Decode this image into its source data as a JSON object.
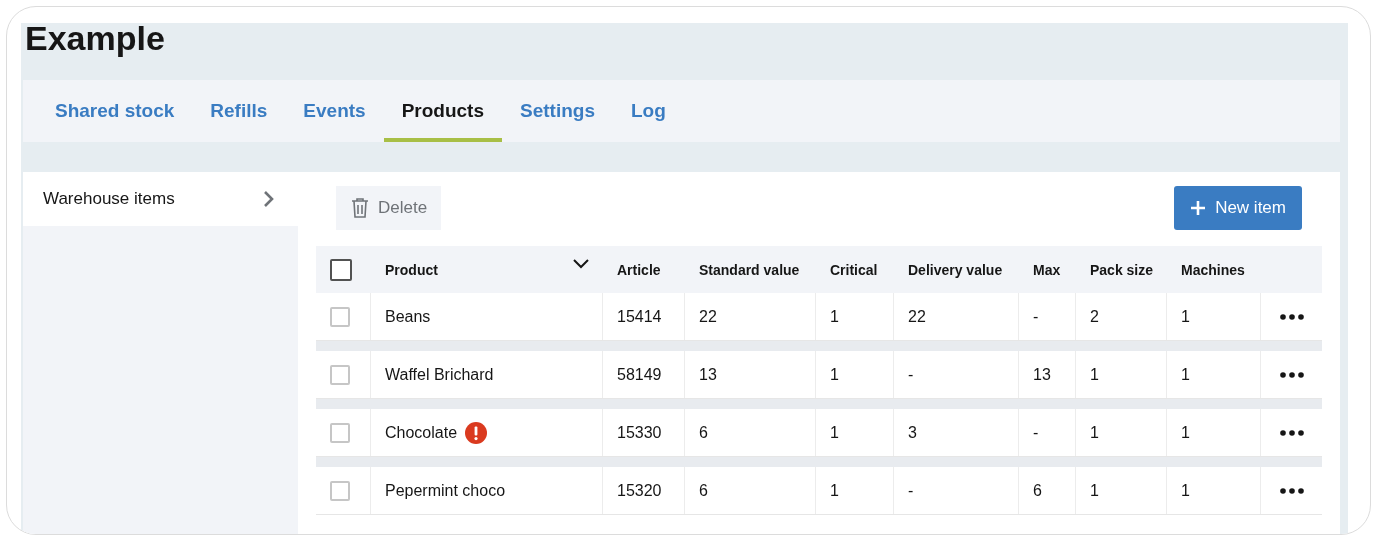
{
  "title": "Example",
  "tabs": [
    {
      "label": "Shared stock",
      "selected": false
    },
    {
      "label": "Refills",
      "selected": false
    },
    {
      "label": "Events",
      "selected": false
    },
    {
      "label": "Products",
      "selected": true
    },
    {
      "label": "Settings",
      "selected": false
    },
    {
      "label": "Log",
      "selected": false
    }
  ],
  "sidebar": {
    "items": [
      {
        "label": "Warehouse items",
        "selected": true
      }
    ]
  },
  "toolbar": {
    "delete_button": {
      "label": "Delete",
      "disabled": true
    },
    "new_button": {
      "label": "New item"
    }
  },
  "table": {
    "select_all": {
      "checked": false
    },
    "columns": [
      "Product",
      "Article",
      "Standard value",
      "Critical",
      "Delivery value",
      "Max",
      "Pack size",
      "Machines"
    ],
    "rows": [
      {
        "checked": false,
        "warning": false,
        "cells": [
          "Beans",
          "15414",
          "22",
          "1",
          "22",
          "-",
          "2",
          "1"
        ]
      },
      {
        "checked": false,
        "warning": false,
        "cells": [
          "Waffel Brichard",
          "58149",
          "13",
          "1",
          "-",
          "13",
          "1",
          "1"
        ]
      },
      {
        "checked": false,
        "warning": true,
        "cells": [
          "Chocolate",
          "15330",
          "6",
          "1",
          "3",
          "-",
          "1",
          "1"
        ]
      },
      {
        "checked": false,
        "warning": false,
        "cells": [
          "Pepermint choco",
          "15320",
          "6",
          "1",
          "-",
          "6",
          "1",
          "1"
        ]
      }
    ]
  }
}
